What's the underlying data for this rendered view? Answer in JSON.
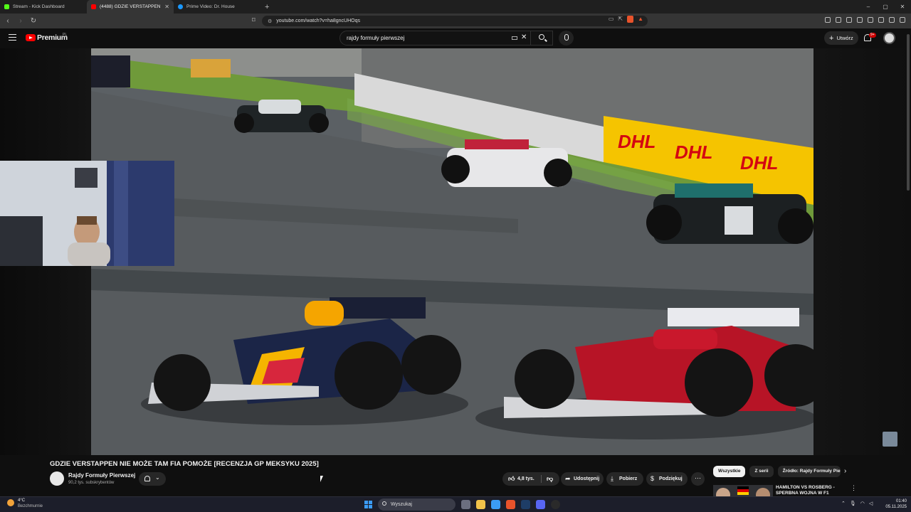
{
  "browser": {
    "tabs": [
      {
        "label": "Stream - Kick Dashboard",
        "color": "#53fc18",
        "active": false
      },
      {
        "label": "(4488) GDZIE VERSTAPPEN NI",
        "color": "#ff0000",
        "active": true
      },
      {
        "label": "Prime Video: Dr. House",
        "color": "#1a98ff",
        "active": false
      }
    ],
    "new_tab": "+",
    "window_controls": [
      "–",
      "▢",
      "✕"
    ],
    "url": "youtube.com/watch?v=ha8gncUHOqs"
  },
  "youtube": {
    "logo_text": "Premium",
    "region": "PL",
    "search_query": "rajdy formuły pierwszej",
    "create_label": "Utwórz",
    "notifications_badge": "9+"
  },
  "video": {
    "title": "GDZIE VERSTAPPEN NIE MOŻE TAM FIA POMOŻE [RECENZJA GP MEKSYKU 2025]",
    "channel_name": "Rajdy Formuły Pierwszej",
    "subscribers": "90,2 tys. subskrybentów",
    "likes": "4,8 tys.",
    "share_label": "Udostępnij",
    "download_label": "Pobierz",
    "thanks_label": "Podziękuj",
    "more_label": "⋯"
  },
  "sidebar": {
    "chips": [
      "Wszystkie",
      "Z serii",
      "Źródło: Rajdy Formuły Pier"
    ],
    "recommendation_title": "HAMILTON VS ROSBERG - SPERBNA WOJNA W F1"
  },
  "taskbar": {
    "temperature": "4°C",
    "weather": "Bezchmurnie",
    "search_placeholder": "Wyszukaj",
    "time": "01:40",
    "date": "05.11.2025"
  },
  "colors": {
    "accent": "#ff0000",
    "background": "#0f0f0f",
    "dhl_yellow": "#f5c400",
    "dhl_red": "#d40511"
  }
}
